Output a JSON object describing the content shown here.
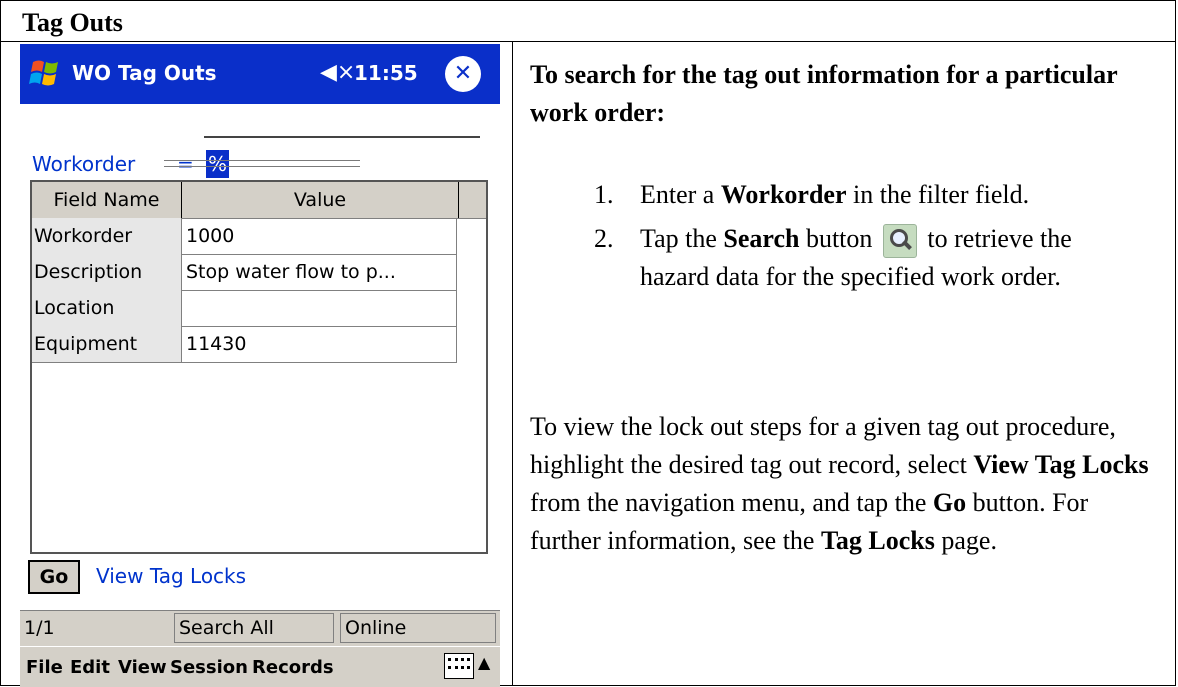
{
  "doc": {
    "section_title": "Tag Outs"
  },
  "pda": {
    "title": "WO Tag Outs",
    "time": "11:55",
    "filter": {
      "label": "Workorder",
      "operator": "=",
      "value": "%"
    },
    "grid": {
      "headers": [
        "Field Name",
        "Value"
      ],
      "rows": [
        {
          "name": "Workorder",
          "value": "1000"
        },
        {
          "name": "Description",
          "value": "Stop water flow to p..."
        },
        {
          "name": "Location",
          "value": ""
        },
        {
          "name": "Equipment",
          "value": "11430"
        }
      ]
    },
    "go_label": "Go",
    "nav_label": "View Tag Locks",
    "status": {
      "page": "1/1",
      "search": "Search All",
      "mode": "Online"
    },
    "menu": [
      "File",
      "Edit",
      "View",
      "Session",
      "Records"
    ],
    "icons": [
      "binoculars-icon",
      "grid-icon",
      "back-arrow-icon",
      "record-list-icon",
      "record-detail-icon",
      "add-icon",
      "delete-icon",
      "save-icon",
      "search-icon"
    ]
  },
  "instructions": {
    "heading": "To search for the tag out information for a particular work order:",
    "step1_pre": "Enter a ",
    "step1_bold": "Workorder",
    "step1_post": " in the filter field.",
    "step2_pre": "Tap the ",
    "step2_bold": "Search",
    "step2_mid": " button ",
    "step2_post": " to retrieve the hazard data for the specified work order.",
    "para_a": "To view the lock out steps for a given tag out procedure, highlight the desired tag out record, select ",
    "para_b": "View Tag Locks",
    "para_c": " from the navigation menu, and tap the ",
    "para_d": "Go",
    "para_e": " button.  For further information, see the ",
    "para_f": "Tag Locks",
    "para_g": " page."
  },
  "colors": {
    "titlebar": "#0a2fc9",
    "link": "#0033cc",
    "chrome": "#d4d0c8"
  }
}
